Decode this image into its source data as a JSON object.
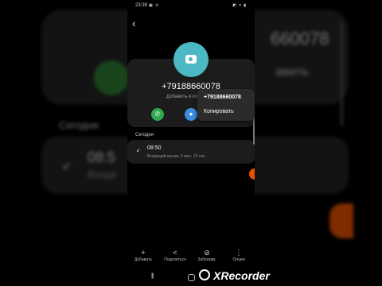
{
  "status_bar": {
    "time": "23:39",
    "left_icons": "▣ ⊙",
    "right_icons": "◩ ▾ ▮"
  },
  "contact": {
    "number": "+79188660078",
    "add_label": "Добавить в контакты",
    "avatar_color": "#4cb8c4"
  },
  "actions": {
    "call_color": "#2fa84f",
    "message_color": "#3b8de0"
  },
  "popup": {
    "number": "+79188660078",
    "copy_label": "Копировать"
  },
  "history": {
    "section_title": "Сегодня",
    "entries": [
      {
        "time": "08:50",
        "description": "Входящий вызов, 0 мин. 13 сек."
      }
    ]
  },
  "toolbar": {
    "items": [
      {
        "icon": "plus-icon",
        "label": "Добавить"
      },
      {
        "icon": "share-icon",
        "label": "Поделиться"
      },
      {
        "icon": "block-icon",
        "label": "Заблокир."
      },
      {
        "icon": "more-icon",
        "label": "Опции"
      }
    ]
  },
  "background": {
    "number_fragment": "660078",
    "add_fragment": "авить",
    "today_label": "Сегодня",
    "time_fragment": "08:5",
    "incoming_fragment": "Входя"
  },
  "watermark": {
    "text": "XRecorder"
  }
}
